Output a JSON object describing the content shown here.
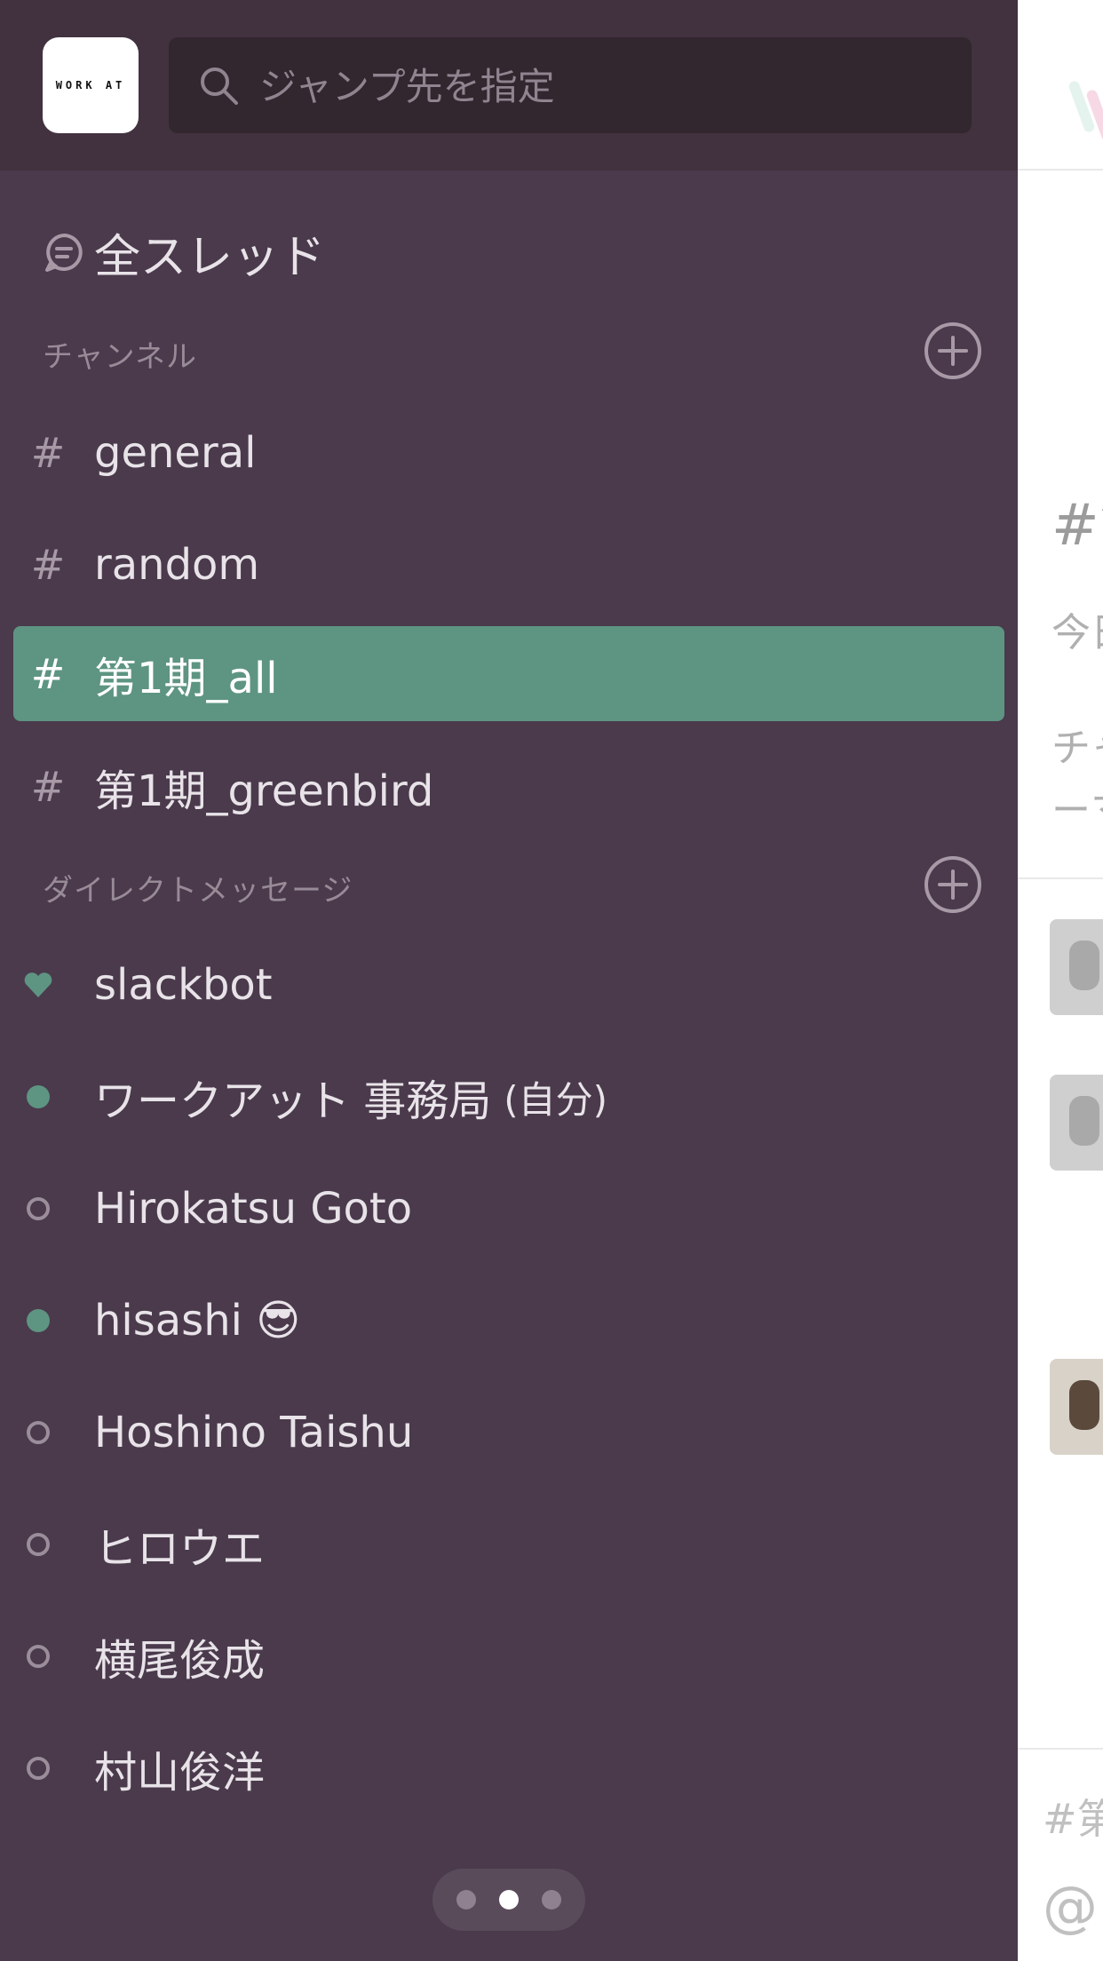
{
  "team": {
    "logo_text": "WORK AT"
  },
  "search": {
    "placeholder": "ジャンプ先を指定"
  },
  "threads": {
    "label": "全スレッド"
  },
  "channels": {
    "header": "チャンネル",
    "items": [
      {
        "name": "general"
      },
      {
        "name": "random"
      },
      {
        "name": "第1期_all",
        "selected": true
      },
      {
        "name": "第1期_greenbird"
      }
    ]
  },
  "dms": {
    "header": "ダイレクトメッセージ",
    "items": [
      {
        "name": "slackbot",
        "status": "heart"
      },
      {
        "name": "ワークアット 事務局",
        "suffix": "(自分)",
        "status": "online"
      },
      {
        "name": "Hirokatsu Goto",
        "status": "offline"
      },
      {
        "name": "hisashi 😎",
        "status": "online"
      },
      {
        "name": "Hoshino Taishu",
        "status": "offline"
      },
      {
        "name": "ヒロウエ",
        "status": "offline"
      },
      {
        "name": "横尾俊成",
        "status": "offline"
      },
      {
        "name": "村山俊洋",
        "status": "offline"
      }
    ]
  },
  "pager": {
    "count": 3,
    "active_index": 1
  },
  "peek": {
    "channel_title": "#第",
    "line1": "今日",
    "line2": "チャ",
    "line3": "ーマ",
    "footer_channel": "#第",
    "footer_at": "@"
  },
  "colors": {
    "sidebar_bg": "#4a3a4c",
    "topbar_bg": "#42323f",
    "selected_bg": "#5e9482",
    "online": "#5e9482"
  }
}
